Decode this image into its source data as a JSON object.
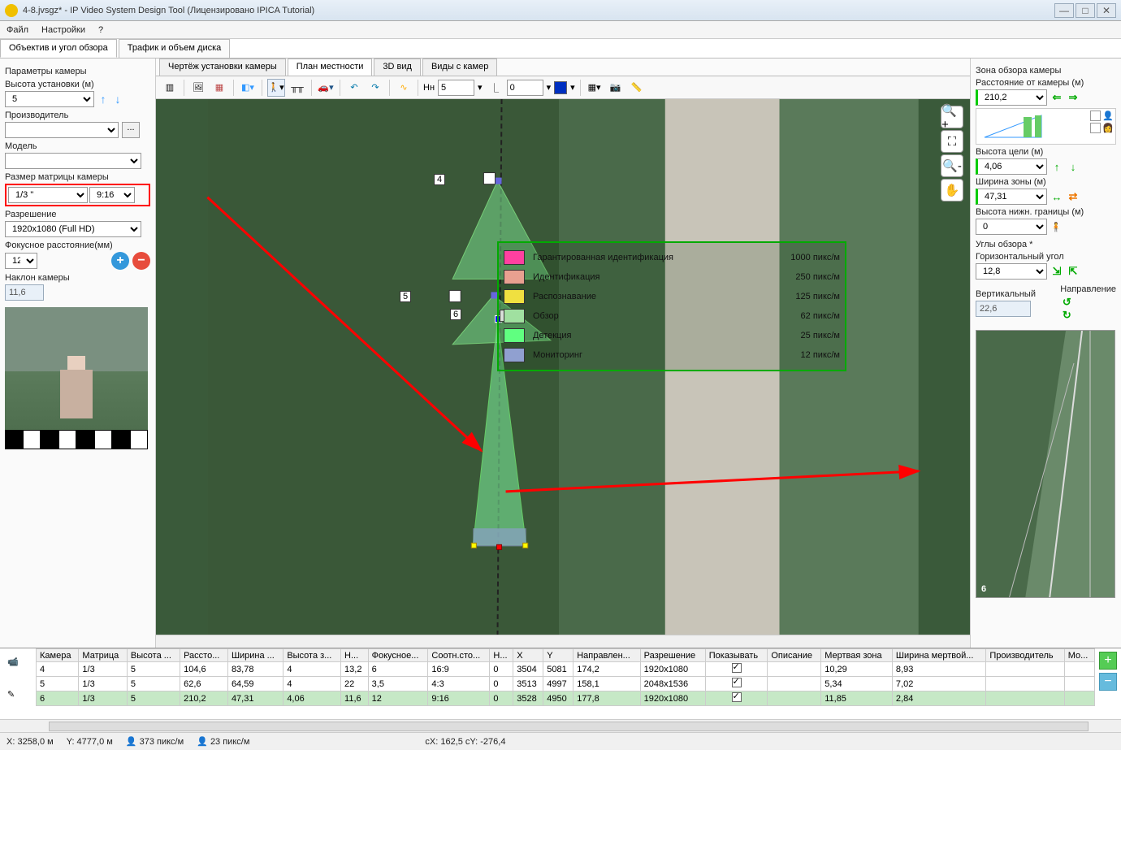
{
  "window": {
    "title": "4-8.jvsgz* - IP Video System Design Tool (Лицензировано  IPICA Tutorial)"
  },
  "menu": {
    "file": "Файл",
    "settings": "Настройки",
    "help": "?"
  },
  "maintabs": {
    "lens": "Объектив и угол обзора",
    "traffic": "Трафик и объем диска"
  },
  "left": {
    "params_title": "Параметры камеры",
    "height_label": "Высота установки (м)",
    "height_value": "5",
    "manufacturer_label": "Производитель",
    "manufacturer_value": "",
    "model_label": "Модель",
    "model_value": "",
    "matrix_label": "Размер матрицы камеры",
    "matrix_size": "1/3 \"",
    "matrix_aspect": "9:16",
    "resolution_label": "Разрешение",
    "resolution_value": "1920x1080 (Full HD)",
    "focal_label": "Фокусное расстояние(мм)",
    "focal_value": "12",
    "tilt_label": "Наклон камеры",
    "tilt_value": "11,6"
  },
  "subtabs": {
    "drawing": "Чертёж установки камеры",
    "plan": "План местности",
    "view3d": "3D вид",
    "views": "Виды с камер"
  },
  "toolbar": {
    "h_label": "Нн",
    "h_value": "5",
    "l_value": "0",
    "color": "#0030c0"
  },
  "legend": {
    "rows": [
      {
        "label": "Гарантированная идентификация",
        "value": "1000",
        "unit": "пикс/м",
        "color": "#ff40a0"
      },
      {
        "label": "Идентификация",
        "value": "250",
        "unit": "пикс/м",
        "color": "#e8a090"
      },
      {
        "label": "Распознавание",
        "value": "125",
        "unit": "пикс/м",
        "color": "#f0e040"
      },
      {
        "label": "Обзор",
        "value": "62",
        "unit": "пикс/м",
        "color": "#a0e0a0"
      },
      {
        "label": "Детекция",
        "value": "25",
        "unit": "пикс/м",
        "color": "#60ff80"
      },
      {
        "label": "Мониторинг",
        "value": "12",
        "unit": "пикс/м",
        "color": "#90a0d0"
      }
    ]
  },
  "cam_labels": {
    "c4": "4",
    "c5": "5",
    "c6": "6"
  },
  "right": {
    "title": "Зона обзора камеры",
    "dist_label": "Расстояние от камеры (м)",
    "dist_value": "210,2",
    "target_h_label": "Высота цели (м)",
    "target_h_value": "4,06",
    "zone_w_label": "Ширина зоны (м)",
    "zone_w_value": "47,31",
    "lower_h_label": "Высота нижн. границы (м)",
    "lower_h_value": "0",
    "angles_title": "Углы обзора *",
    "h_angle_label": "Горизонтальный угол",
    "h_angle_value": "12,8",
    "v_angle_label": "Вертикальный",
    "v_angle_value": "22,6",
    "dir_label": "Направление",
    "preview_label": "6"
  },
  "table": {
    "headers": [
      "Камера",
      "Матрица",
      "Высота ...",
      "Рассто...",
      "Ширина ...",
      "Высота з...",
      "Н...",
      "Фокусное...",
      "Соотн.сто...",
      "Н...",
      "X",
      "Y",
      "Направлен...",
      "Разрешение",
      "Показывать",
      "Описание",
      "Мертвая зона",
      "Ширина мертвой...",
      "Производитель",
      "Мо..."
    ],
    "rows": [
      {
        "cells": [
          "4",
          "1/3",
          "5",
          "104,6",
          "83,78",
          "4",
          "13,2",
          "6",
          "16:9",
          "0",
          "3504",
          "5081",
          "174,2",
          "1920x1080"
        ],
        "show": true,
        "dead": "10,29",
        "deadw": "8,93"
      },
      {
        "cells": [
          "5",
          "1/3",
          "5",
          "62,6",
          "64,59",
          "4",
          "22",
          "3,5",
          "4:3",
          "0",
          "3513",
          "4997",
          "158,1",
          "2048x1536"
        ],
        "show": true,
        "dead": "5,34",
        "deadw": "7,02"
      },
      {
        "cells": [
          "6",
          "1/3",
          "5",
          "210,2",
          "47,31",
          "4,06",
          "11,6",
          "12",
          "9:16",
          "0",
          "3528",
          "4950",
          "177,8",
          "1920x1080"
        ],
        "show": true,
        "dead": "11,85",
        "deadw": "2,84",
        "selected": true
      }
    ]
  },
  "status": {
    "x": "X: 3258,0 м",
    "y": "Y: 4777,0 м",
    "px1": "373 пикс/м",
    "px2": "23 пикс/м",
    "cxy": "cX: 162,5 cY: -276,4"
  }
}
